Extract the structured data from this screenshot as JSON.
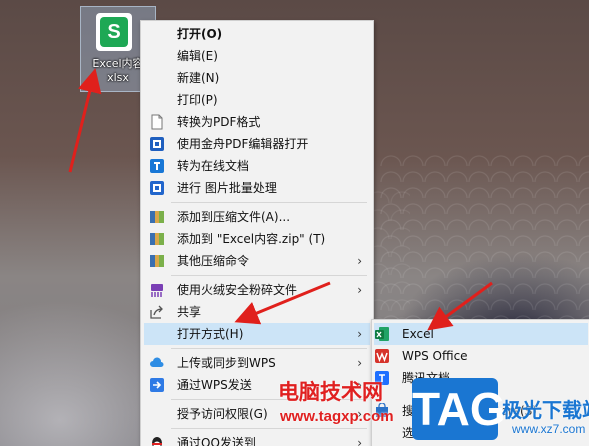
{
  "desktop": {
    "file": {
      "name": "Excel内容\nxlsx",
      "icon": "wps-spreadsheet-icon",
      "icon_letter": "S"
    }
  },
  "context_menu": {
    "items": [
      {
        "label": "打开(O)",
        "icon": "",
        "bold": true
      },
      {
        "label": "编辑(E)",
        "icon": ""
      },
      {
        "label": "新建(N)",
        "icon": ""
      },
      {
        "label": "打印(P)",
        "icon": ""
      },
      {
        "label": "转换为PDF格式",
        "icon": "document-icon"
      },
      {
        "label": "使用金舟PDF编辑器打开",
        "icon": "pdf-editor-icon"
      },
      {
        "label": "转为在线文档",
        "icon": "cloud-doc-icon"
      },
      {
        "label": "进行 图片批量处理",
        "icon": "image-batch-icon"
      },
      {
        "label": "添加到压缩文件(A)...",
        "icon": "archive-icon"
      },
      {
        "label": "添加到 \"Excel内容.zip\" (T)",
        "icon": "archive-icon"
      },
      {
        "label": "其他压缩命令",
        "icon": "archive-icon",
        "submenu": true
      },
      {
        "label": "使用火绒安全粉碎文件",
        "icon": "shredder-icon",
        "submenu": true
      },
      {
        "label": "共享",
        "icon": "share-icon"
      },
      {
        "label": "打开方式(H)",
        "icon": "",
        "submenu": true,
        "highlighted": true
      },
      {
        "label": "上传或同步到WPS",
        "icon": "wps-cloud-icon",
        "submenu": true
      },
      {
        "label": "通过WPS发送",
        "icon": "send-arrow-icon",
        "submenu": true
      },
      {
        "label": "授予访问权限(G)",
        "icon": "",
        "submenu": true
      },
      {
        "label": "通过QQ发送到",
        "icon": "qq-icon",
        "submenu": true
      }
    ]
  },
  "open_with_submenu": {
    "items": [
      {
        "label": "Excel",
        "icon": "excel-icon",
        "highlighted": true
      },
      {
        "label": "WPS Office",
        "icon": "wps-office-icon"
      },
      {
        "label": "腾讯文档",
        "icon": "tencent-docs-icon"
      },
      {
        "label": "搜索 Microsoft Store(S)",
        "icon": "store-icon"
      },
      {
        "label": "选择其他应用(C)",
        "icon": ""
      }
    ]
  },
  "watermark": {
    "site_name": "电脑技术网",
    "site_url": "www.tagxp.com",
    "logo_text": "TAG",
    "right_text": "极光下载站",
    "right_url": "www.xz7.com"
  },
  "colors": {
    "menu_bg": "#f2f2f2",
    "highlight": "#cce4f7",
    "arrow_red": "#e0201c",
    "watermark_red": "#e02020",
    "tag_blue": "#1a76d2"
  }
}
